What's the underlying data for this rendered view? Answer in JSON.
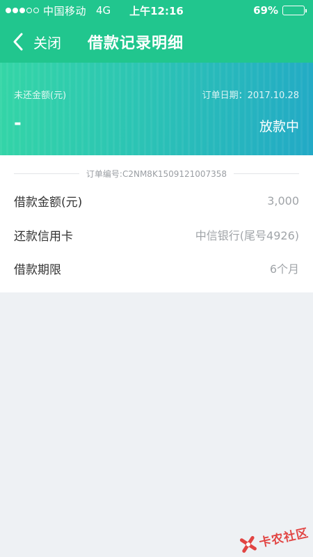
{
  "status_bar": {
    "carrier": "中国移动",
    "network": "4G",
    "time": "上午12:16",
    "battery_percent": "69%",
    "battery_level": 0.69,
    "signal_bars_filled": 3,
    "signal_bars_total": 5
  },
  "nav": {
    "back_icon": "chevron-left-icon",
    "close_label": "关闭",
    "title": "借款记录明细"
  },
  "summary": {
    "unpaid_label": "未还金额(元)",
    "order_date": "订单日期：2017.10.28",
    "unpaid_value": "-",
    "status": "放款中"
  },
  "detail": {
    "order_no": "订单编号:C2NM8K1509121007358",
    "rows": [
      {
        "label": "借款金额(元)",
        "value": "3,000"
      },
      {
        "label": "还款信用卡",
        "value": "中信银行(尾号4926)"
      },
      {
        "label": "借款期限",
        "value": "6个月"
      }
    ]
  },
  "watermark": {
    "text": "卡农社区",
    "icon": "kanong-logo-icon"
  },
  "colors": {
    "brand_green": "#21c68e",
    "gradient_start": "#34d6a6",
    "gradient_end": "#22a9c6",
    "page_bg": "#eef1f4",
    "watermark_red": "#e0322f"
  }
}
